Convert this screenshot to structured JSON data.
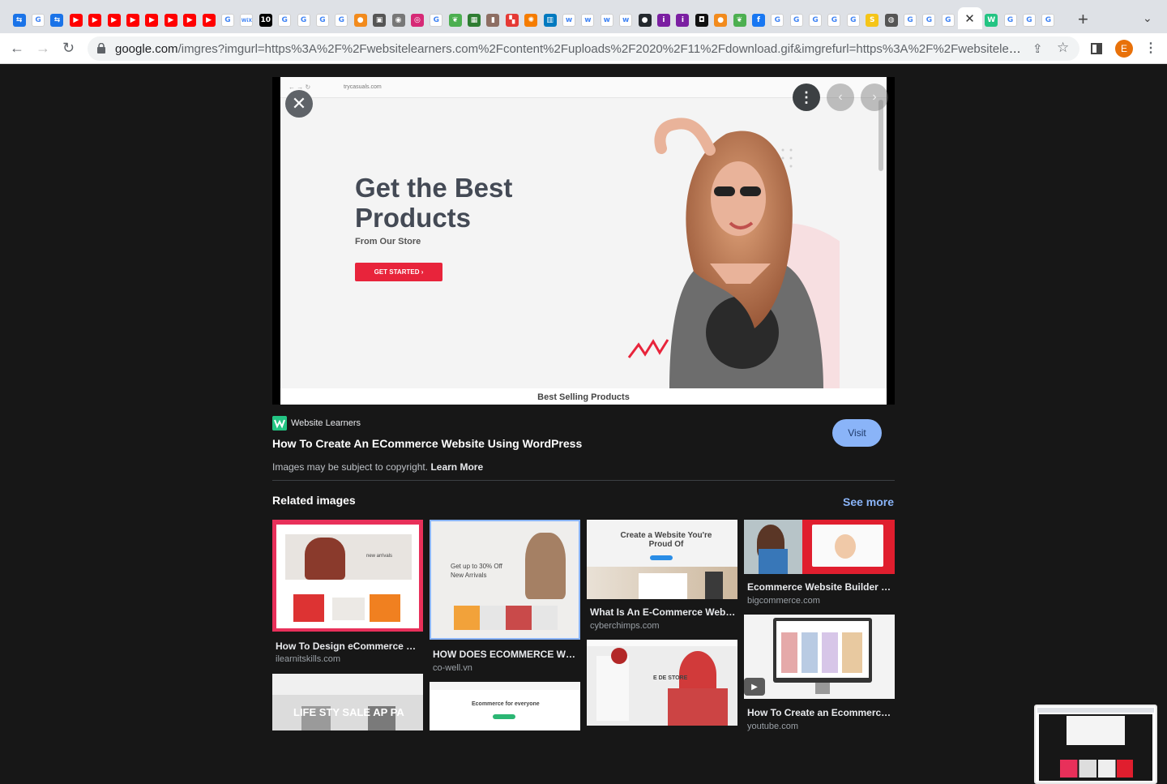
{
  "browser": {
    "tabs": [
      {
        "icon": "share-icon",
        "color": "#1a73e8",
        "glyph": "⇆"
      },
      {
        "icon": "google-icon",
        "color": "#ffffff",
        "glyph": "G"
      },
      {
        "icon": "share-icon",
        "color": "#1a73e8",
        "glyph": "⇆"
      },
      {
        "icon": "youtube-icon",
        "color": "#ff0000",
        "glyph": "▶"
      },
      {
        "icon": "youtube-icon",
        "color": "#ff0000",
        "glyph": "▶"
      },
      {
        "icon": "youtube-icon",
        "color": "#ff0000",
        "glyph": "▶"
      },
      {
        "icon": "youtube-icon",
        "color": "#ff0000",
        "glyph": "▶"
      },
      {
        "icon": "youtube-icon",
        "color": "#ff0000",
        "glyph": "▶"
      },
      {
        "icon": "youtube-icon",
        "color": "#ff0000",
        "glyph": "▶"
      },
      {
        "icon": "youtube-icon",
        "color": "#ff0000",
        "glyph": "▶"
      },
      {
        "icon": "youtube-icon",
        "color": "#ff0000",
        "glyph": "▶"
      },
      {
        "icon": "google-icon",
        "color": "#ffffff",
        "glyph": "G"
      },
      {
        "icon": "wix-icon",
        "color": "#ffffff",
        "glyph": "WiX"
      },
      {
        "icon": "ten-icon",
        "color": "#000000",
        "glyph": "10"
      },
      {
        "icon": "google-icon",
        "color": "#ffffff",
        "glyph": "G"
      },
      {
        "icon": "google-icon",
        "color": "#ffffff",
        "glyph": "G"
      },
      {
        "icon": "google-icon",
        "color": "#ffffff",
        "glyph": "G"
      },
      {
        "icon": "google-icon",
        "color": "#ffffff",
        "glyph": "G"
      },
      {
        "icon": "orange-icon",
        "color": "#f28b1d",
        "glyph": "●"
      },
      {
        "icon": "camera-icon",
        "color": "#555555",
        "glyph": "▣"
      },
      {
        "icon": "chrome-icon",
        "color": "#777777",
        "glyph": "◉"
      },
      {
        "icon": "instagram-icon",
        "color": "#d62976",
        "glyph": "◎"
      },
      {
        "icon": "google-icon",
        "color": "#ffffff",
        "glyph": "G"
      },
      {
        "icon": "leaf-icon",
        "color": "#4caf50",
        "glyph": "❦"
      },
      {
        "icon": "calendar-icon",
        "color": "#2e7d32",
        "glyph": "▦"
      },
      {
        "icon": "book-icon",
        "color": "#8d6e63",
        "glyph": "▮"
      },
      {
        "icon": "grid-icon",
        "color": "#e53935",
        "glyph": "▚"
      },
      {
        "icon": "pinwheel-icon",
        "color": "#f57c00",
        "glyph": "✺"
      },
      {
        "icon": "trello-icon",
        "color": "#0079bf",
        "glyph": "▥"
      },
      {
        "icon": "w-icon",
        "color": "#ffffff",
        "glyph": "w"
      },
      {
        "icon": "w-icon",
        "color": "#ffffff",
        "glyph": "w"
      },
      {
        "icon": "w-icon",
        "color": "#ffffff",
        "glyph": "w"
      },
      {
        "icon": "w-icon",
        "color": "#ffffff",
        "glyph": "w"
      },
      {
        "icon": "github-icon",
        "color": "#24292e",
        "glyph": "●"
      },
      {
        "icon": "purple-icon",
        "color": "#7b1fa2",
        "glyph": "i"
      },
      {
        "icon": "purple-icon",
        "color": "#7b1fa2",
        "glyph": "i"
      },
      {
        "icon": "black-square-icon",
        "color": "#111111",
        "glyph": "◘"
      },
      {
        "icon": "orange-icon",
        "color": "#f28b1d",
        "glyph": "●"
      },
      {
        "icon": "leaf-icon",
        "color": "#4caf50",
        "glyph": "❦"
      },
      {
        "icon": "facebook-icon",
        "color": "#1877f2",
        "glyph": "f"
      },
      {
        "icon": "google-icon",
        "color": "#ffffff",
        "glyph": "G"
      },
      {
        "icon": "google-icon",
        "color": "#ffffff",
        "glyph": "G"
      },
      {
        "icon": "google-icon",
        "color": "#ffffff",
        "glyph": "G"
      },
      {
        "icon": "google-icon",
        "color": "#ffffff",
        "glyph": "G"
      },
      {
        "icon": "google-icon",
        "color": "#ffffff",
        "glyph": "G"
      },
      {
        "icon": "s-icon",
        "color": "#f5c518",
        "glyph": "S"
      },
      {
        "icon": "globe-icon",
        "color": "#555555",
        "glyph": "◍"
      },
      {
        "icon": "google-icon",
        "color": "#ffffff",
        "glyph": "G"
      },
      {
        "icon": "google-icon",
        "color": "#ffffff",
        "glyph": "G"
      },
      {
        "icon": "google-icon",
        "color": "#ffffff",
        "glyph": "G"
      }
    ],
    "tabs_after": [
      {
        "icon": "website-learners-icon",
        "color": "#23c483",
        "glyph": "W"
      },
      {
        "icon": "google-icon",
        "color": "#ffffff",
        "glyph": "G"
      },
      {
        "icon": "google-icon",
        "color": "#ffffff",
        "glyph": "G"
      },
      {
        "icon": "google-icon",
        "color": "#ffffff",
        "glyph": "G"
      }
    ],
    "active_tab_close": "✕",
    "new_tab": "+",
    "tab_search": "⌄",
    "url_host": "google.com",
    "url_rest": "/imgres?imgurl=https%3A%2F%2Fwebsitelearners.com%2Fcontent%2Fuploads%2F2020%2F11%2Fdownload.gif&imgrefurl=https%3A%2F%2Fwebsitelear...",
    "back": "←",
    "forward": "→",
    "reload": "↻",
    "share": "⇪",
    "star": "☆",
    "profile_initial": "E",
    "menu": "⋮"
  },
  "preview": {
    "shot_url": "trycasuals.com",
    "headline": "Get the Best Products",
    "subheadline": "From Our Store",
    "cta": "GET STARTED  ›",
    "footer": "Best Selling Products",
    "close": "✕",
    "more": "⋮",
    "prev": "‹",
    "next": "›"
  },
  "result": {
    "source_name": "Website Learners",
    "title": "How To Create An ECommerce Website Using WordPress",
    "visit_label": "Visit",
    "copyright_text": "Images may be subject to copyright.",
    "learn_more": "Learn More"
  },
  "related": {
    "heading": "Related images",
    "see_more": "See more",
    "items": [
      {
        "caption": "How To Design eCommerce W...",
        "domain": "ilearnitskills.com",
        "thumb_text": "new arrivals"
      },
      {
        "caption": "HOW DOES ECOMMERCE WEB...",
        "domain": "co-well.vn",
        "thumb_text": "Get up to 30% Off New Arrivals"
      },
      {
        "caption": "What Is An E-Commerce Webs...",
        "domain": "cyberchimps.com",
        "thumb_text": "Create a Website You're Proud Of"
      },
      {
        "caption": "Ecommerce Website Builder C...",
        "domain": "bigcommerce.com",
        "thumb_text": ""
      },
      {
        "caption": "How To Create an Ecommerce ...",
        "domain": "youtube.com",
        "thumb_text": ""
      },
      {
        "caption": "",
        "domain": "",
        "thumb_text": "E DE STORE"
      },
      {
        "caption": "",
        "domain": "",
        "thumb_text": "LIFE STY  SALE  AP PA"
      },
      {
        "caption": "",
        "domain": "",
        "thumb_text": "Ecommerce for everyone"
      }
    ]
  },
  "colors": {
    "page_bg": "#171717",
    "accent": "#8ab4f8",
    "cta_red": "#e8243b"
  }
}
